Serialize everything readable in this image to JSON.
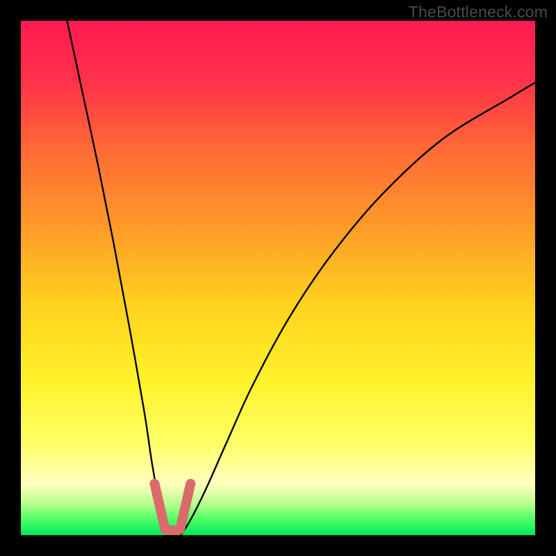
{
  "watermark": "TheBottleneck.com",
  "colors": {
    "black": "#000000",
    "curve": "#000000",
    "marker": "#d96b6b",
    "gradient_stops": [
      {
        "offset": 0.0,
        "color": "#ff1a52"
      },
      {
        "offset": 0.12,
        "color": "#ff3249"
      },
      {
        "offset": 0.25,
        "color": "#ff6a36"
      },
      {
        "offset": 0.4,
        "color": "#ff9a28"
      },
      {
        "offset": 0.55,
        "color": "#ffd21e"
      },
      {
        "offset": 0.7,
        "color": "#fff22a"
      },
      {
        "offset": 0.82,
        "color": "#ffff66"
      },
      {
        "offset": 0.9,
        "color": "#ffffc0"
      },
      {
        "offset": 0.94,
        "color": "#b8ff8a"
      },
      {
        "offset": 0.97,
        "color": "#4cff66"
      },
      {
        "offset": 1.0,
        "color": "#00e85a"
      }
    ]
  },
  "chart_data": {
    "type": "line",
    "title": "",
    "xlabel": "",
    "ylabel": "",
    "xlim": [
      0,
      100
    ],
    "ylim": [
      0,
      100
    ],
    "series": [
      {
        "name": "bottleneck-curve",
        "x": [
          9,
          12,
          15,
          18,
          21,
          24,
          25.5,
          27,
          28.5,
          30,
          31,
          33,
          36,
          40,
          45,
          52,
          60,
          70,
          82,
          95,
          100
        ],
        "values": [
          100,
          86,
          72,
          57,
          41,
          24,
          14,
          6,
          2,
          0,
          0,
          3,
          9,
          18,
          29,
          42,
          54,
          66,
          77,
          85,
          88
        ]
      }
    ],
    "annotations": [
      {
        "name": "optimal-region-marker",
        "x_range": [
          26,
          33
        ],
        "y_range": [
          0,
          10
        ]
      }
    ]
  }
}
